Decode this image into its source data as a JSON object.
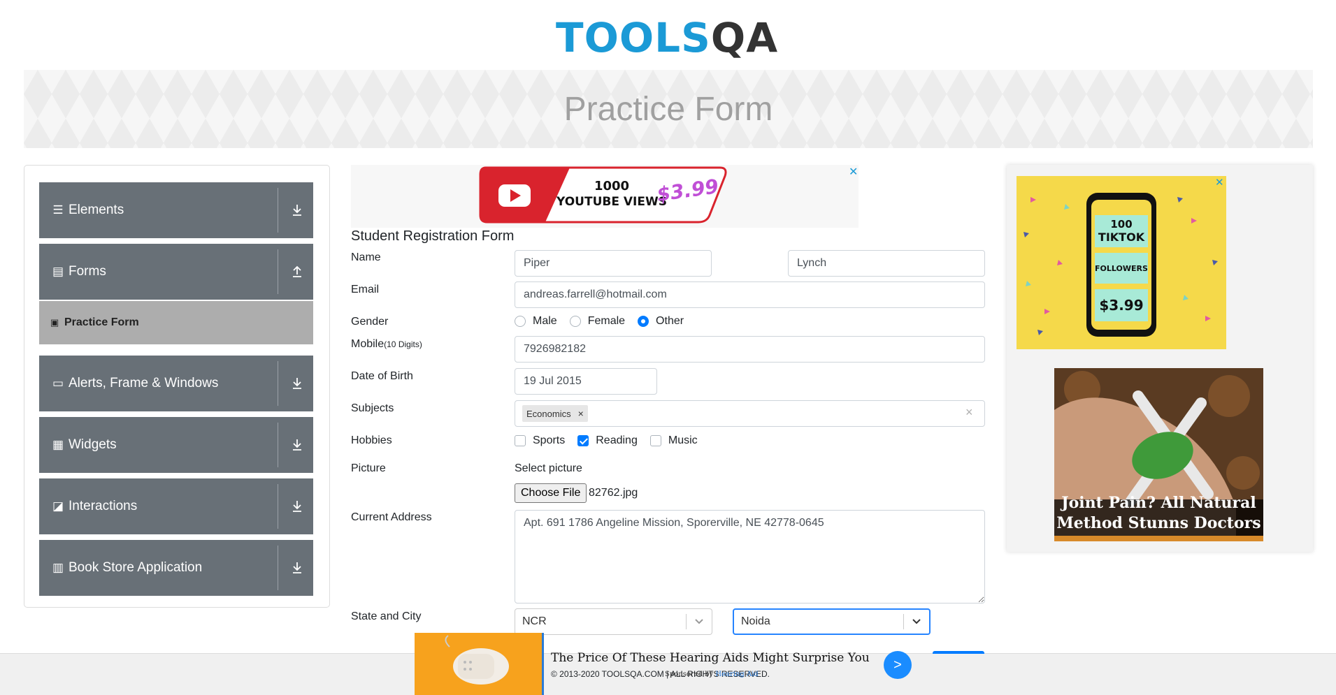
{
  "header": {
    "logo_part1": "TOOLS",
    "logo_part2": "QA",
    "page_title": "Practice Form"
  },
  "sidebar": {
    "groups": [
      {
        "label": "Elements",
        "icon": "menu-icon",
        "arrow": "download-arrow-icon"
      },
      {
        "label": "Forms",
        "icon": "document-icon",
        "arrow": "upload-arrow-icon"
      },
      {
        "label": "Alerts, Frame & Windows",
        "icon": "window-icon",
        "arrow": "download-arrow-icon"
      },
      {
        "label": "Widgets",
        "icon": "grid-icon",
        "arrow": "download-arrow-icon"
      },
      {
        "label": "Interactions",
        "icon": "interaction-icon",
        "arrow": "download-arrow-icon"
      },
      {
        "label": "Book Store Application",
        "icon": "books-icon",
        "arrow": "download-arrow-icon"
      }
    ],
    "active_item": {
      "label": "Practice Form",
      "icon": "form-icon"
    }
  },
  "ads": {
    "youtube": {
      "line1": "1000",
      "line2": "YOUTUBE VIEWS",
      "price": "$3.99"
    },
    "tiktok": {
      "line1": "100",
      "line2": "TIKTOK",
      "line3": "FOLLOWERS",
      "price": "$3.99"
    },
    "joint": {
      "line1": "Joint Pain? All Natural",
      "line2": "Method Stunns Doctors"
    },
    "bottom": {
      "headline": "The Price Of These Hearing Aids Might Surprise You",
      "sponsored_prefix": "Sponsored by",
      "sponsor": "Hearing Aid",
      "go": ">"
    }
  },
  "form": {
    "title": "Student Registration Form",
    "labels": {
      "name": "Name",
      "email": "Email",
      "gender": "Gender",
      "mobile": "Mobile",
      "mobile_hint": "(10 Digits)",
      "dob": "Date of Birth",
      "subjects": "Subjects",
      "hobbies": "Hobbies",
      "picture": "Picture",
      "address": "Current Address",
      "state_city": "State and City"
    },
    "first_name": "Piper",
    "last_name": "Lynch",
    "email": "andreas.farrell@hotmail.com",
    "gender_options": [
      "Male",
      "Female",
      "Other"
    ],
    "gender_selected": "Other",
    "mobile": "7926982182",
    "dob": "19 Jul 2015",
    "subjects": [
      "Economics"
    ],
    "hobby_options": [
      "Sports",
      "Reading",
      "Music"
    ],
    "hobbies_checked": [
      "Reading"
    ],
    "select_picture_label": "Select picture",
    "choose_file_label": "Choose File",
    "file_name": "82762.jpg",
    "address": "Apt. 691 1786 Angeline Mission, Sporerville, NE 42778-0645",
    "state": "NCR",
    "city": "Noida"
  },
  "footer": {
    "copyright": "© 2013-2020 TOOLSQA.COM | ALL RIGHTS RESERVED."
  },
  "colors": {
    "sidebar_bg": "#687077",
    "active_item_bg": "#adadad",
    "accent": "#007bff",
    "logo_blue": "#1b9ad6"
  }
}
